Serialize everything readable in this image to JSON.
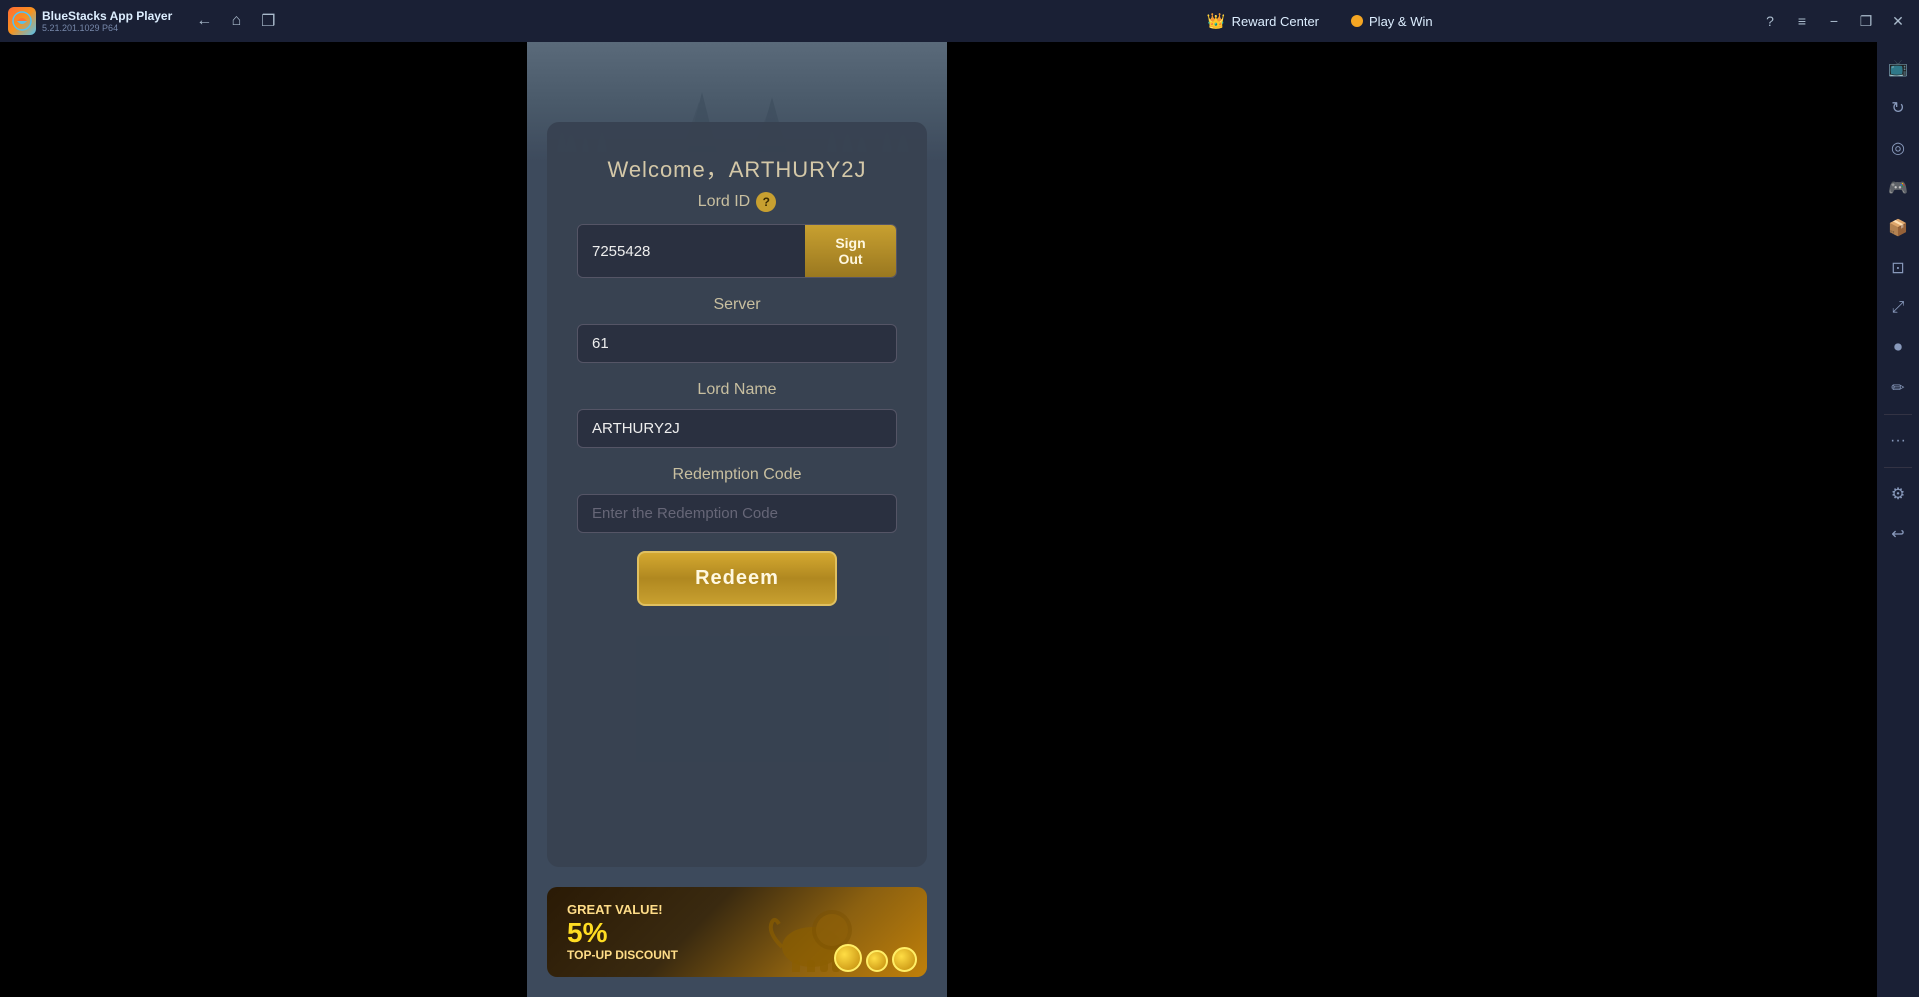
{
  "titlebar": {
    "app_name": "BlueStacks App Player",
    "app_version": "5.21.201.1029  P64",
    "back_label": "←",
    "home_label": "⌂",
    "multi_label": "❐",
    "reward_center_label": "Reward Center",
    "play_win_label": "Play & Win",
    "help_label": "?",
    "menu_label": "≡",
    "minimize_label": "−",
    "restore_label": "❐",
    "close_label": "✕"
  },
  "game": {
    "welcome_text": "Welcome，ARTHURY2J",
    "lord_id_label": "Lord ID",
    "lord_id_value": "7255428",
    "sign_out_label": "Sign Out",
    "server_label": "Server",
    "server_value": "61",
    "lord_name_label": "Lord Name",
    "lord_name_value": "ARTHURY2J",
    "redemption_code_label": "Redemption Code",
    "redemption_code_placeholder": "Enter the Redemption Code",
    "redeem_button_label": "Redeem"
  },
  "banner": {
    "great_value_text": "GREAT VALUE!",
    "percent": "5%",
    "top_up_text": "TOP-UP DISCOUNT"
  },
  "sidebar": {
    "icons": [
      {
        "name": "settings-icon",
        "symbol": "⚙"
      },
      {
        "name": "display-icon",
        "symbol": "📺"
      },
      {
        "name": "rotate-icon",
        "symbol": "↻"
      },
      {
        "name": "location-icon",
        "symbol": "◎"
      },
      {
        "name": "gamepad-icon",
        "symbol": "🎮"
      },
      {
        "name": "apk-icon",
        "symbol": "📦"
      },
      {
        "name": "screenshot-icon",
        "symbol": "⊡"
      },
      {
        "name": "resize-icon",
        "symbol": "⤢"
      },
      {
        "name": "record-icon",
        "symbol": "⏺"
      },
      {
        "name": "edit-icon",
        "symbol": "✏"
      },
      {
        "name": "more-icon",
        "symbol": "…"
      },
      {
        "name": "gear2-icon",
        "symbol": "⚙"
      },
      {
        "name": "back2-icon",
        "symbol": "↩"
      }
    ]
  }
}
